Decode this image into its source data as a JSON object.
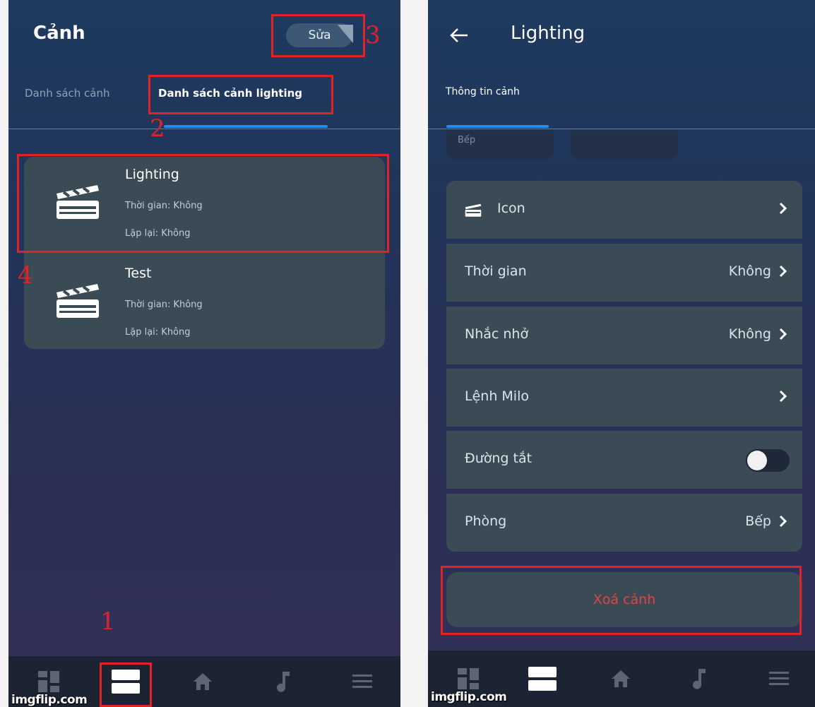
{
  "left_screen": {
    "title": "Cảnh",
    "edit_label": "Sửa",
    "tabs": [
      {
        "label": "Danh sách cảnh",
        "active": false
      },
      {
        "label": "Danh sách cảnh lighting",
        "active": true
      }
    ],
    "scenes": [
      {
        "name": "Lighting",
        "time": "Thời gian: Không",
        "repeat": "Lặp lại: Không",
        "icon": "clapperboard-icon"
      },
      {
        "name": "Test",
        "time": "Thời gian: Không",
        "repeat": "Lặp lại: Không",
        "icon": "clapperboard-icon"
      }
    ],
    "annotations": [
      "1",
      "2",
      "3",
      "4"
    ]
  },
  "right_screen": {
    "title": "Lighting",
    "back_icon": "arrow-left-icon",
    "tab": "Thông tin cảnh",
    "room_chip": "Bếp",
    "rows": [
      {
        "label": "Icon",
        "value": "",
        "type": "link",
        "icon": "clapperboard-icon"
      },
      {
        "label": "Thời gian",
        "value": "Không",
        "type": "link"
      },
      {
        "label": "Nhắc nhở",
        "value": "Không",
        "type": "link"
      },
      {
        "label": "Lệnh Milo",
        "value": "",
        "type": "link"
      },
      {
        "label": "Đường tắt",
        "value": "",
        "type": "toggle",
        "on": false
      },
      {
        "label": "Phòng",
        "value": "Bếp",
        "type": "link"
      }
    ],
    "delete_label": "Xoá cảnh"
  },
  "bottom_nav": {
    "items": [
      "dashboard-icon",
      "scenes-icon",
      "home-icon",
      "music-icon",
      "menu-icon"
    ],
    "left_active_index": 1
  },
  "watermark": "imgflip.com",
  "colors": {
    "accent_blue": "#1e8ef0",
    "annotation_red": "#e32228",
    "delete_red": "#e0453f",
    "card_bg": "#3a4b55"
  }
}
